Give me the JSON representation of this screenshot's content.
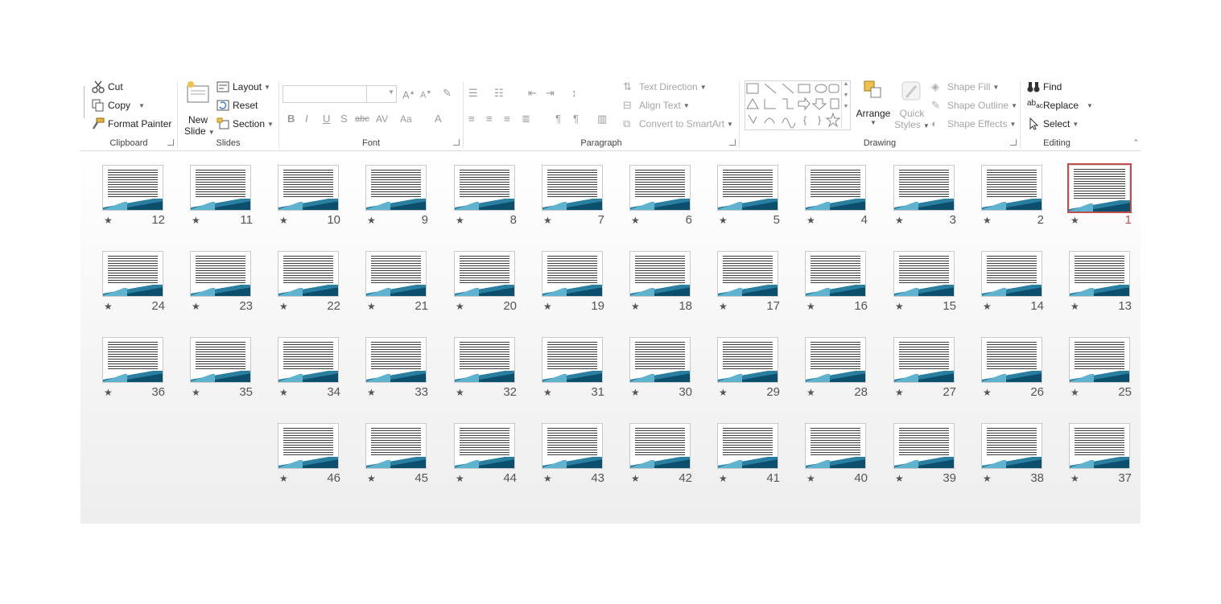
{
  "ribbon": {
    "clipboard": {
      "label": "Clipboard",
      "cut": "Cut",
      "copy": "Copy",
      "format_painter": "Format Painter"
    },
    "slides": {
      "label": "Slides",
      "new_slide_line1": "New",
      "new_slide_line2": "Slide",
      "layout": "Layout",
      "reset": "Reset",
      "section": "Section"
    },
    "font": {
      "label": "Font",
      "font_name": "",
      "font_size": ""
    },
    "paragraph": {
      "label": "Paragraph",
      "text_direction": "Text Direction",
      "align_text": "Align Text",
      "convert_smartart": "Convert to SmartArt"
    },
    "drawing": {
      "label": "Drawing",
      "arrange": "Arrange",
      "quick_styles_line1": "Quick",
      "quick_styles_line2": "Styles",
      "shape_fill": "Shape Fill",
      "shape_outline": "Shape Outline",
      "shape_effects": "Shape Effects"
    },
    "editing": {
      "label": "Editing",
      "find": "Find",
      "replace": "Replace",
      "select": "Select"
    }
  },
  "colors": {
    "accent": "#c0504d",
    "slide_band": "#0b4f6c"
  },
  "slides": [
    {
      "num": "1",
      "selected": true
    },
    {
      "num": "2"
    },
    {
      "num": "3"
    },
    {
      "num": "4"
    },
    {
      "num": "5"
    },
    {
      "num": "6"
    },
    {
      "num": "7"
    },
    {
      "num": "8"
    },
    {
      "num": "9"
    },
    {
      "num": "10"
    },
    {
      "num": "11"
    },
    {
      "num": "12"
    },
    {
      "num": "13"
    },
    {
      "num": "14"
    },
    {
      "num": "15"
    },
    {
      "num": "16"
    },
    {
      "num": "17"
    },
    {
      "num": "18"
    },
    {
      "num": "19"
    },
    {
      "num": "20"
    },
    {
      "num": "21"
    },
    {
      "num": "22"
    },
    {
      "num": "23"
    },
    {
      "num": "24"
    },
    {
      "num": "25"
    },
    {
      "num": "26"
    },
    {
      "num": "27"
    },
    {
      "num": "28"
    },
    {
      "num": "29"
    },
    {
      "num": "30"
    },
    {
      "num": "31"
    },
    {
      "num": "32"
    },
    {
      "num": "33"
    },
    {
      "num": "34"
    },
    {
      "num": "35"
    },
    {
      "num": "36"
    },
    {
      "num": "37"
    },
    {
      "num": "38"
    },
    {
      "num": "39"
    },
    {
      "num": "40"
    },
    {
      "num": "41"
    },
    {
      "num": "42"
    },
    {
      "num": "43"
    },
    {
      "num": "44"
    },
    {
      "num": "45"
    },
    {
      "num": "46"
    }
  ],
  "star_glyph": "★"
}
